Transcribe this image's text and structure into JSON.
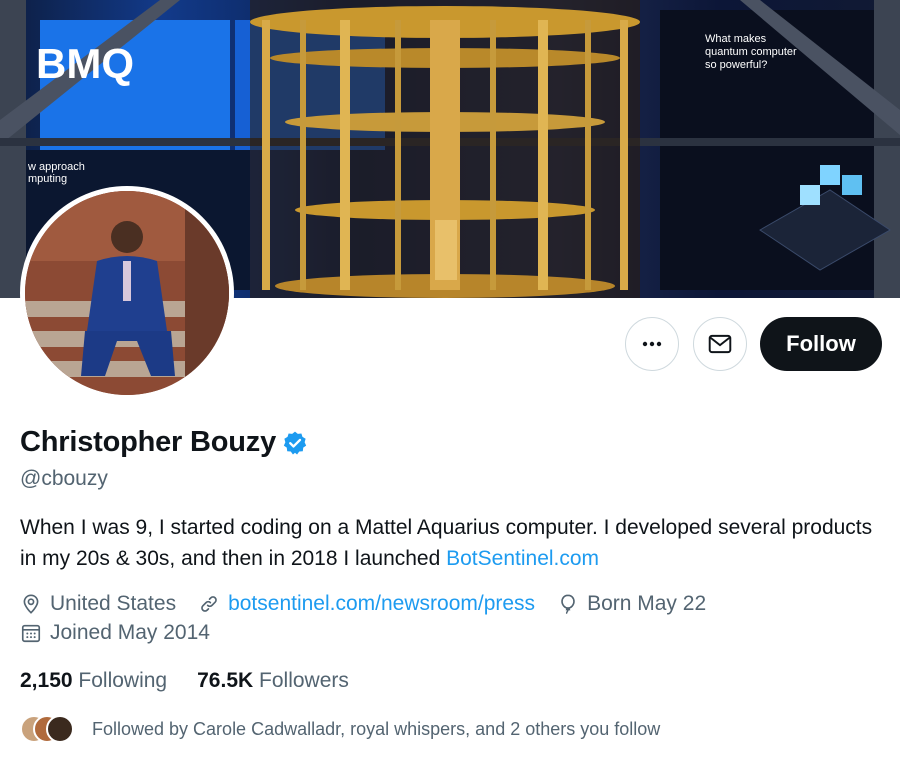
{
  "profile": {
    "name": "Christopher Bouzy",
    "handle": "@cbouzy",
    "bio_text": "When I was 9, I started coding on a Mattel Aquarius computer. I developed several products in my 20s & 30s, and then in 2018 I launched ",
    "bio_link": "BotSentinel.com",
    "verified": true
  },
  "meta": {
    "location": "United States",
    "website": "botsentinel.com/newsroom/press",
    "birthday": "Born May 22",
    "joined": "Joined May 2014"
  },
  "stats": {
    "following_count": "2,150",
    "following_label": "Following",
    "followers_count": "76.5K",
    "followers_label": "Followers"
  },
  "followed_by": "Followed by Carole Cadwalladr, royal whispers, and 2 others you follow",
  "actions": {
    "more_icon": "more-horizontal-icon",
    "message_icon": "envelope-icon",
    "follow_label": "Follow"
  },
  "banner": {
    "sign_text": "BMQ",
    "panel_heading": "What makes quantum computers so powerful?",
    "left_heading": "w approach mputing"
  },
  "colors": {
    "accent": "#1d9bf0",
    "text_primary": "#0f1419",
    "text_secondary": "#536471",
    "follow_button": "#0f1419"
  }
}
